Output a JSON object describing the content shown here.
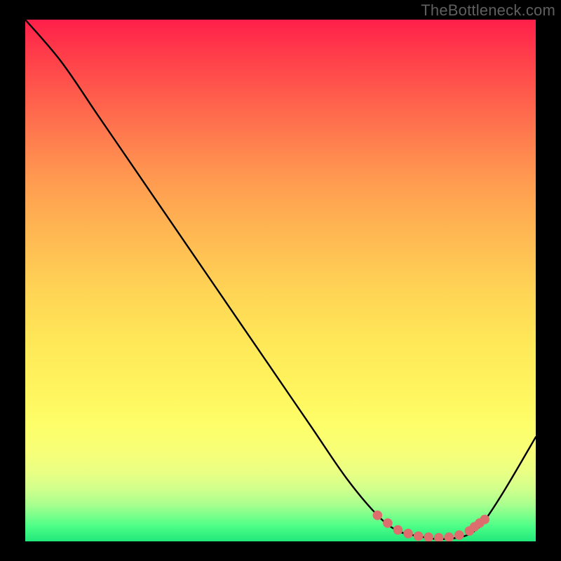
{
  "watermark": "TheBottleneck.com",
  "chart_data": {
    "type": "line",
    "title": "",
    "xlabel": "",
    "ylabel": "",
    "series": [
      {
        "name": "curve",
        "x": [
          0,
          7,
          14,
          21,
          28,
          35,
          42,
          49,
          56,
          63,
          69,
          73,
          77,
          80,
          83,
          86,
          88,
          90,
          94,
          100
        ],
        "values": [
          100,
          92,
          82,
          72,
          62,
          52,
          42,
          32,
          22,
          12,
          5,
          2,
          1,
          0.5,
          0.5,
          1,
          2,
          4,
          10,
          20
        ]
      },
      {
        "name": "highlight-dots",
        "x": [
          69,
          71,
          73,
          75,
          77,
          79,
          81,
          83,
          85,
          87,
          88,
          89,
          90
        ],
        "values": [
          5,
          3.5,
          2.2,
          1.5,
          1,
          0.8,
          0.7,
          0.8,
          1.2,
          2,
          2.8,
          3.5,
          4.2
        ]
      }
    ],
    "xlim": [
      0,
      100
    ],
    "ylim": [
      0,
      100
    ],
    "colors": {
      "curve": "#000000",
      "dots": "#DD6E6E"
    }
  }
}
